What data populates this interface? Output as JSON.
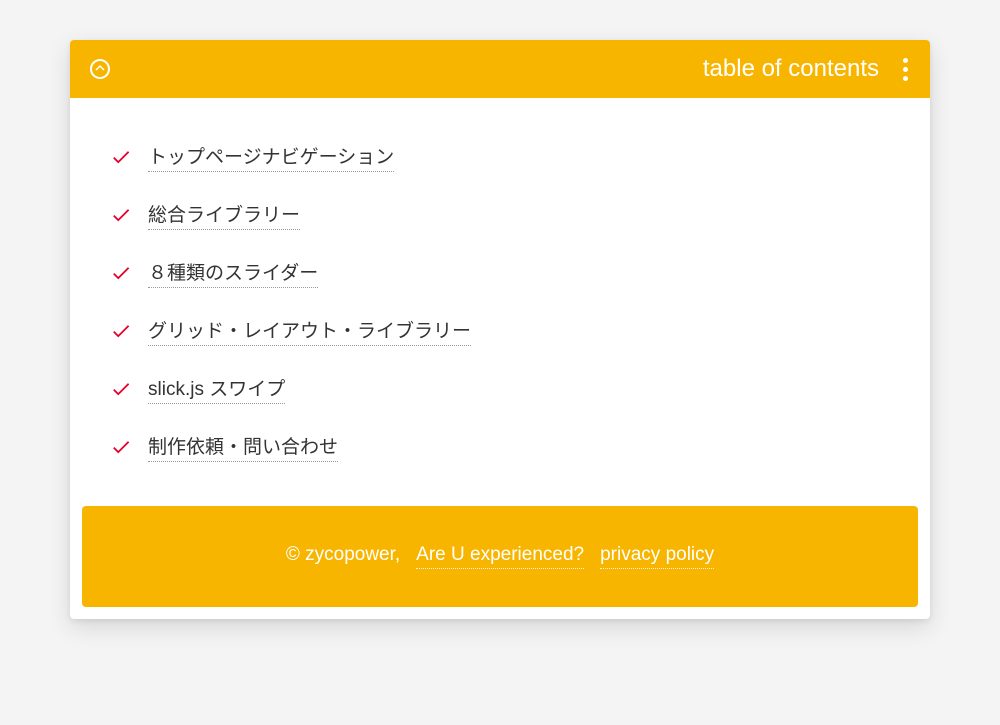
{
  "header": {
    "title": "table of contents"
  },
  "toc": {
    "items": [
      {
        "label": "トップページナビゲーション"
      },
      {
        "label": "総合ライブラリー"
      },
      {
        "label": "８種類のスライダー"
      },
      {
        "label": "グリッド・レイアウト・ライブラリー"
      },
      {
        "label": "slick.js スワイプ"
      },
      {
        "label": "制作依頼・問い合わせ"
      }
    ]
  },
  "footer": {
    "copyright": "© zycopower,",
    "links": [
      {
        "label": "Are U experienced?"
      },
      {
        "label": "privacy policy"
      }
    ]
  },
  "colors": {
    "accent": "#f8b500",
    "check": "#e4002b"
  }
}
